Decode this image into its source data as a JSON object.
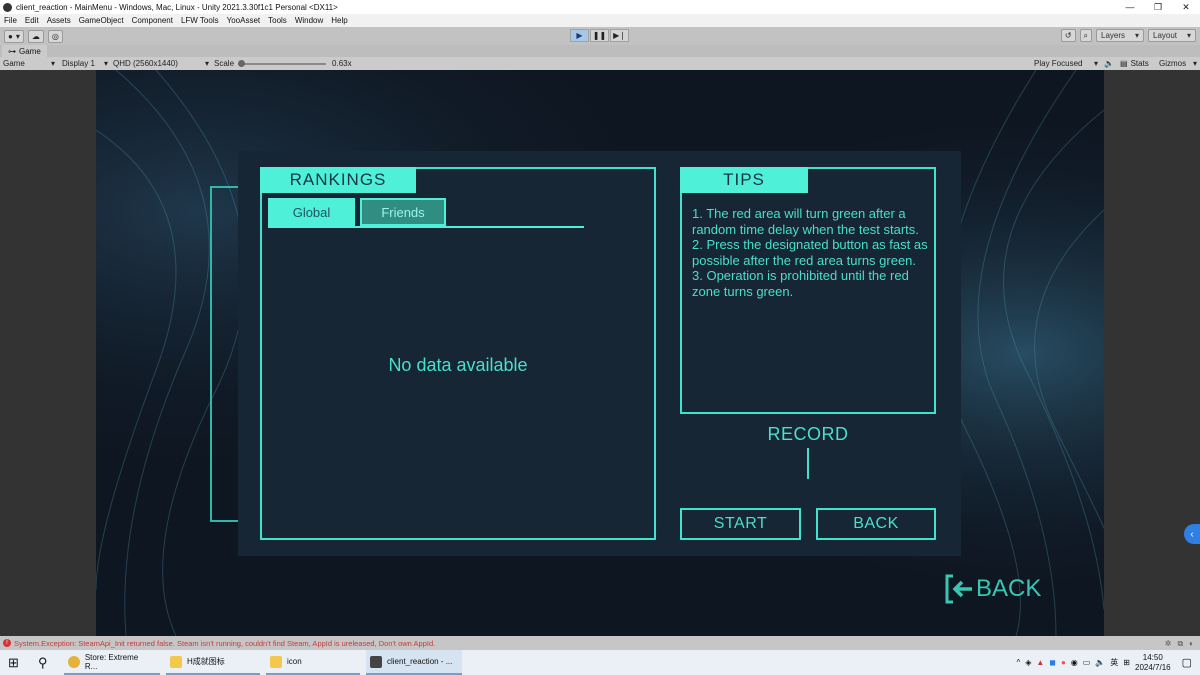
{
  "window": {
    "title": "client_reaction - MainMenu - Windows, Mac, Linux - Unity 2021.3.30f1c1 Personal <DX11>",
    "controls": [
      "—",
      "❐",
      "✕"
    ]
  },
  "menu": [
    "File",
    "Edit",
    "Assets",
    "GameObject",
    "Component",
    "LFW Tools",
    "YooAsset",
    "Tools",
    "Window",
    "Help"
  ],
  "toolbar": {
    "account_label": "●",
    "layers_label": "Layers",
    "layout_label": "Layout"
  },
  "game_tab": {
    "label": "Game"
  },
  "game_toolbar": {
    "view": "Game",
    "display": "Display 1",
    "resolution": "QHD (2560x1440)",
    "scale_label": "Scale",
    "scale_value": "0.63x",
    "play_mode": "Play Focused",
    "stats": "Stats",
    "gizmos": "Gizmos"
  },
  "game": {
    "rankings_title": "RANKINGS",
    "tab_global": "Global",
    "tab_friends": "Friends",
    "no_data": "No data available",
    "tips_title": "TIPS",
    "tips": [
      "1. The red area will turn green after a random time delay when the test starts.",
      "2. Press the designated button as fast as possible after the red area turns green.",
      "3. Operation is prohibited until the red zone turns green."
    ],
    "record_label": "RECORD",
    "start_label": "START",
    "back_label": "BACK",
    "big_back_label": "BACK",
    "accent_color": "#4ff0d8"
  },
  "status": {
    "error": "System.Exception: SteamApi_Init returned false. Steam isn't running, couldn't find Steam, AppId is ureleased, Don't own AppId."
  },
  "taskbar": {
    "apps": [
      {
        "label": "Store: Extreme R...",
        "icon": "chrome-icon"
      },
      {
        "label": "H成就图标",
        "icon": "folder-icon"
      },
      {
        "label": "icon",
        "icon": "folder-icon"
      },
      {
        "label": "client_reaction - ...",
        "icon": "unity-icon"
      }
    ],
    "ime": "英",
    "time": "14:50",
    "date": "2024/7/16"
  }
}
